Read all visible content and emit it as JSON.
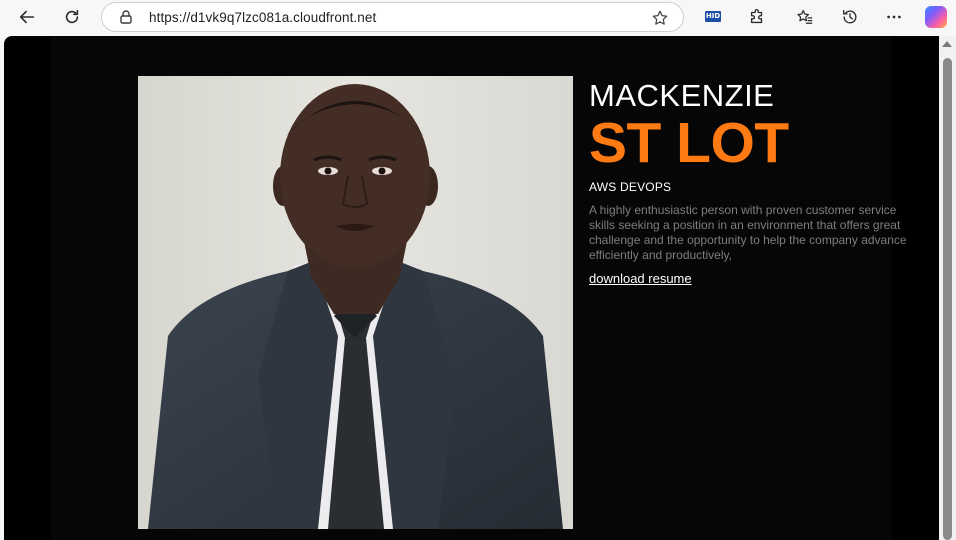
{
  "browser": {
    "url_protocol": "https://",
    "url_host": "d1vk9q7lzc081a.cloudfront.net",
    "extension_badge": "HID",
    "icons": [
      "back-icon",
      "refresh-icon",
      "lock-icon",
      "favorite-star-icon",
      "extensions-icon",
      "favorites-icon",
      "history-icon",
      "more-icon",
      "copilot-icon"
    ]
  },
  "profile": {
    "first_name": "MACKENZIE",
    "last_name": "ST LOT",
    "role": "AWS DEVOPS",
    "bio": "A highly enthusiastic person with proven customer service skills seeking a position in an environment that offers great challenge and the opportunity to help the company advance efficiently and productively,",
    "resume_link": "download resume"
  },
  "colors": {
    "accent": "#ff7a12",
    "page_bg": "#060606",
    "text_muted": "#7e7e7e"
  }
}
